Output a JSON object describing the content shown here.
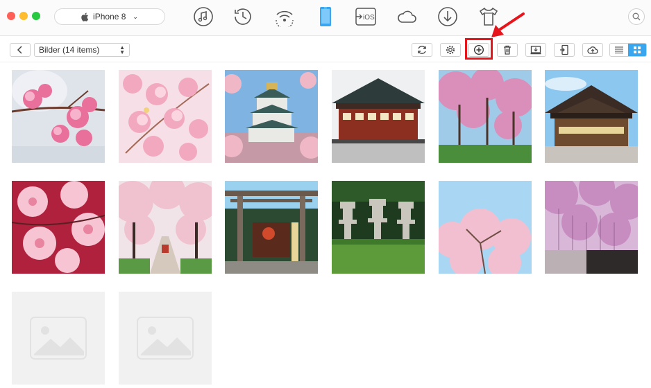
{
  "device": {
    "name": "iPhone 8",
    "chevron": "⌄"
  },
  "nav": [
    {
      "name": "music-icon"
    },
    {
      "name": "history-icon"
    },
    {
      "name": "wifi-sync-icon"
    },
    {
      "name": "phone-icon"
    },
    {
      "name": "to-ios-icon",
      "label": "iOS"
    },
    {
      "name": "cloud-icon"
    },
    {
      "name": "download-icon"
    },
    {
      "name": "tshirt-icon"
    }
  ],
  "toolbar": {
    "album": "Bilder (14 items)"
  },
  "photos": [
    {
      "name": "photo-cherry-blossom-closeup"
    },
    {
      "name": "photo-cherry-blossom-branches"
    },
    {
      "name": "photo-osaka-castle"
    },
    {
      "name": "photo-japanese-temple"
    },
    {
      "name": "photo-cherry-tree-park"
    },
    {
      "name": "photo-shrine-building"
    },
    {
      "name": "photo-cherry-blossom-macro"
    },
    {
      "name": "photo-cherry-tunnel-path"
    },
    {
      "name": "photo-torii-gate"
    },
    {
      "name": "photo-stone-lanterns"
    },
    {
      "name": "photo-cherry-tree-sky"
    },
    {
      "name": "photo-weeping-cherry"
    },
    {
      "name": "photo-placeholder"
    },
    {
      "name": "photo-placeholder"
    }
  ],
  "colors": {
    "accent": "#3aa6f0",
    "highlight": "#e8141c"
  }
}
